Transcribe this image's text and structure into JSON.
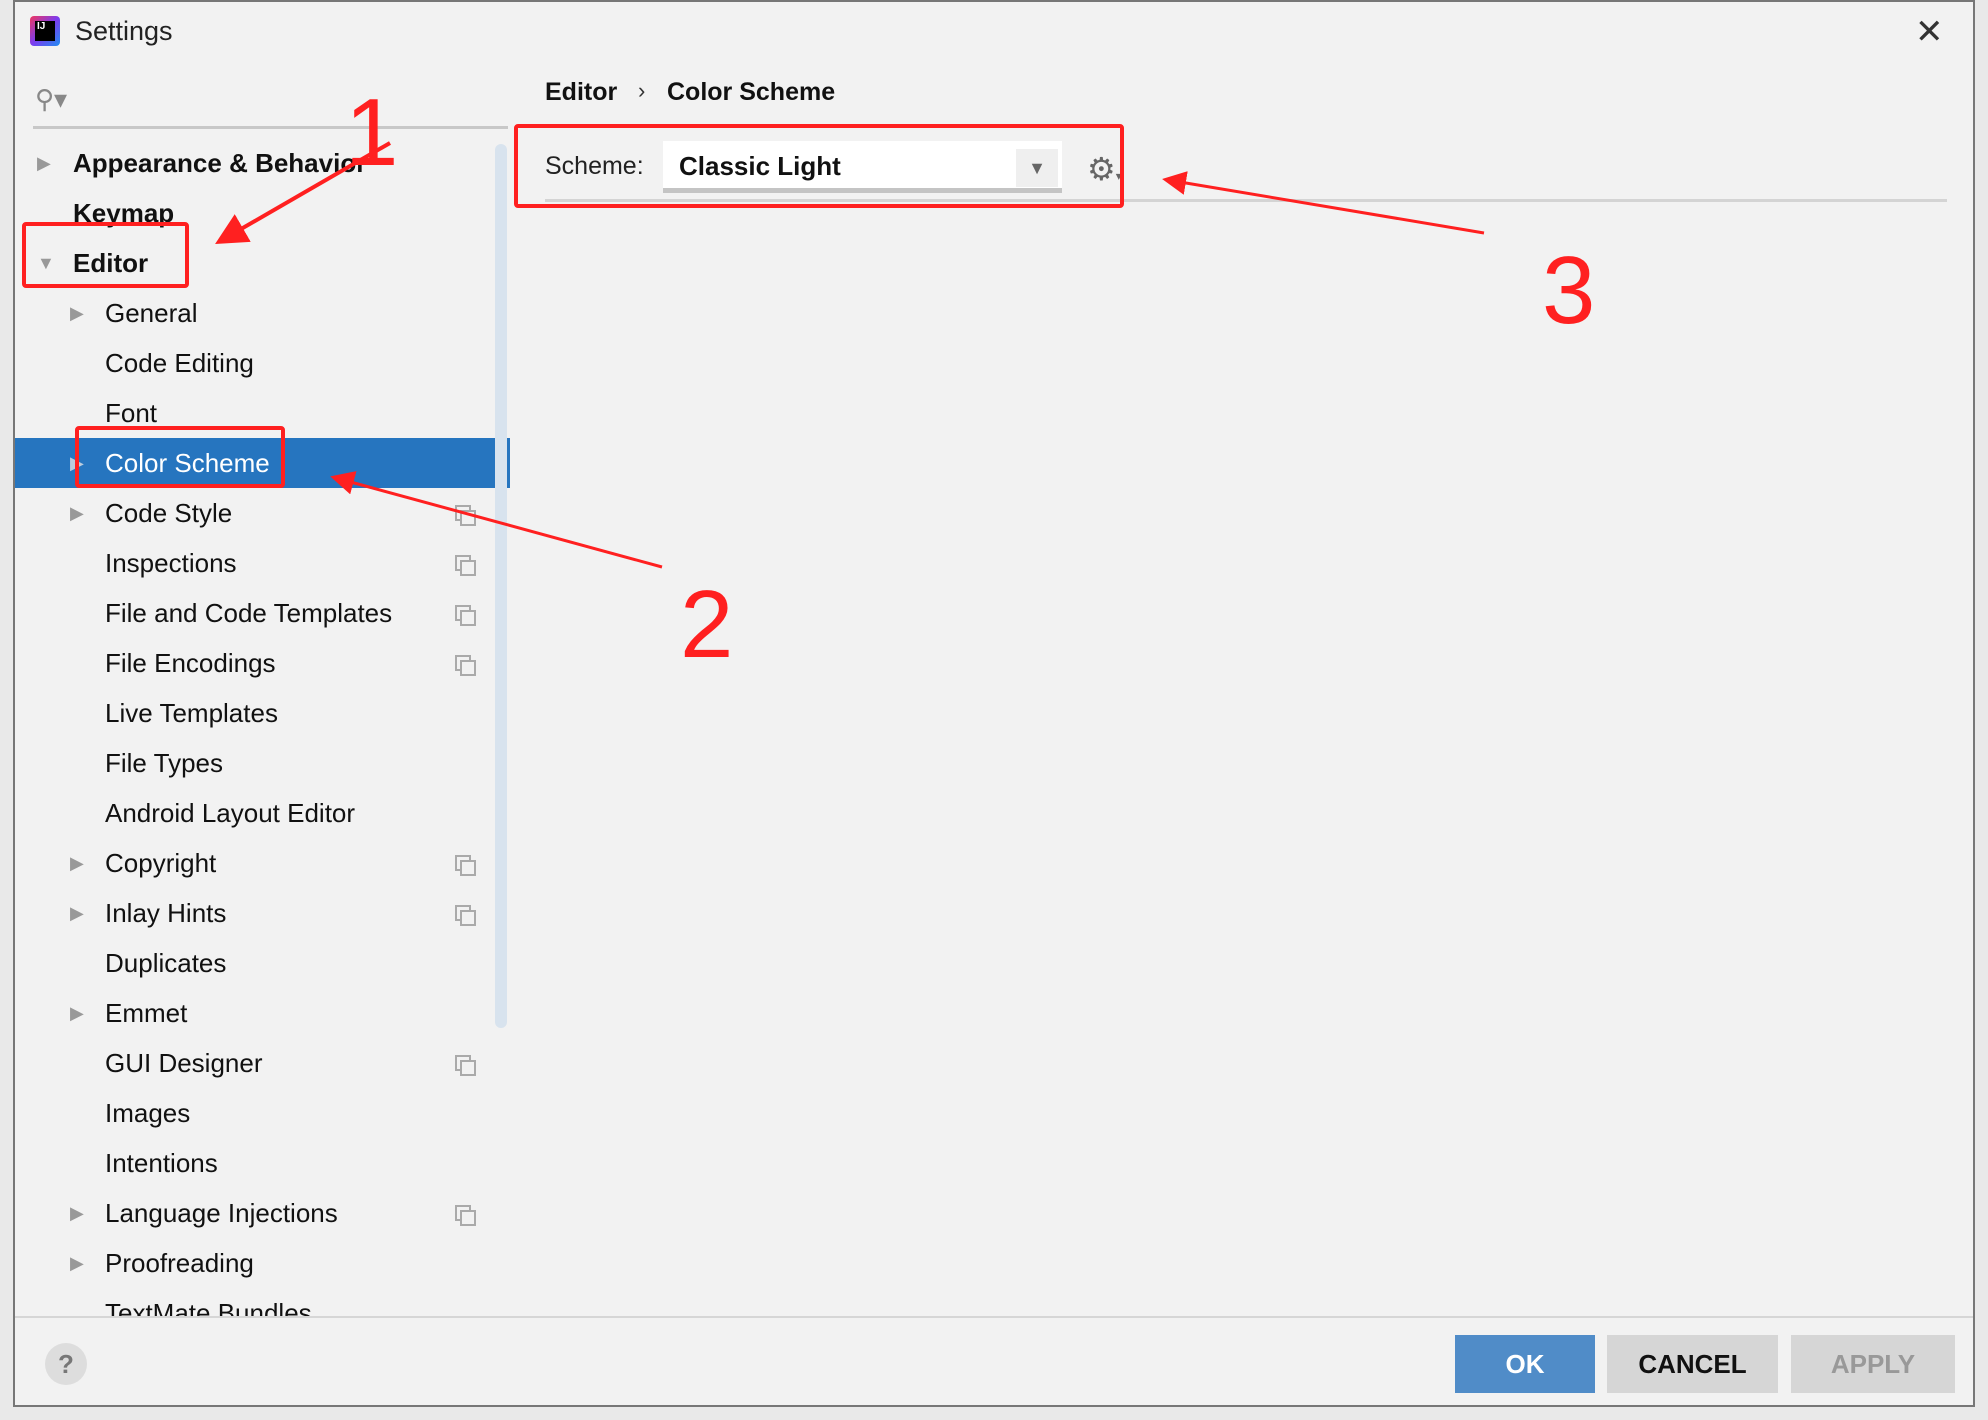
{
  "window": {
    "title": "Settings",
    "close_icon": "close-icon",
    "app_icon_text": "IJ"
  },
  "search": {
    "icon": "search-icon"
  },
  "tree": [
    {
      "label": "Appearance & Behavior",
      "level": 0,
      "arrow": "right",
      "copy": false
    },
    {
      "label": "Keymap",
      "level": 0,
      "arrow": "none",
      "copy": false
    },
    {
      "label": "Editor",
      "level": 0,
      "arrow": "down",
      "copy": false
    },
    {
      "label": "General",
      "level": 1,
      "arrow": "right",
      "copy": false
    },
    {
      "label": "Code Editing",
      "level": 1,
      "arrow": "none",
      "copy": false
    },
    {
      "label": "Font",
      "level": 1,
      "arrow": "none",
      "copy": false
    },
    {
      "label": "Color Scheme",
      "level": 1,
      "arrow": "right",
      "copy": false,
      "selected": true
    },
    {
      "label": "Code Style",
      "level": 1,
      "arrow": "right",
      "copy": true
    },
    {
      "label": "Inspections",
      "level": 1,
      "arrow": "none",
      "copy": true
    },
    {
      "label": "File and Code Templates",
      "level": 1,
      "arrow": "none",
      "copy": true
    },
    {
      "label": "File Encodings",
      "level": 1,
      "arrow": "none",
      "copy": true
    },
    {
      "label": "Live Templates",
      "level": 1,
      "arrow": "none",
      "copy": false
    },
    {
      "label": "File Types",
      "level": 1,
      "arrow": "none",
      "copy": false
    },
    {
      "label": "Android Layout Editor",
      "level": 1,
      "arrow": "none",
      "copy": false
    },
    {
      "label": "Copyright",
      "level": 1,
      "arrow": "right",
      "copy": true
    },
    {
      "label": "Inlay Hints",
      "level": 1,
      "arrow": "right",
      "copy": true
    },
    {
      "label": "Duplicates",
      "level": 1,
      "arrow": "none",
      "copy": false
    },
    {
      "label": "Emmet",
      "level": 1,
      "arrow": "right",
      "copy": false
    },
    {
      "label": "GUI Designer",
      "level": 1,
      "arrow": "none",
      "copy": true
    },
    {
      "label": "Images",
      "level": 1,
      "arrow": "none",
      "copy": false
    },
    {
      "label": "Intentions",
      "level": 1,
      "arrow": "none",
      "copy": false
    },
    {
      "label": "Language Injections",
      "level": 1,
      "arrow": "right",
      "copy": true
    },
    {
      "label": "Proofreading",
      "level": 1,
      "arrow": "right",
      "copy": false
    },
    {
      "label": "TextMate Bundles",
      "level": 1,
      "arrow": "none",
      "copy": false
    }
  ],
  "breadcrumb": {
    "parent": "Editor",
    "separator": "›",
    "current": "Color Scheme"
  },
  "scheme": {
    "label": "Scheme:",
    "value": "Classic Light",
    "gear_icon": "gear-icon"
  },
  "buttons": {
    "ok": "OK",
    "cancel": "CANCEL",
    "apply": "APPLY",
    "help": "?"
  },
  "annotations": {
    "color": "#ff2020",
    "numbers": [
      "1",
      "2",
      "3"
    ]
  },
  "colors": {
    "selection": "#2675bf",
    "ok_button": "#508cc8"
  }
}
